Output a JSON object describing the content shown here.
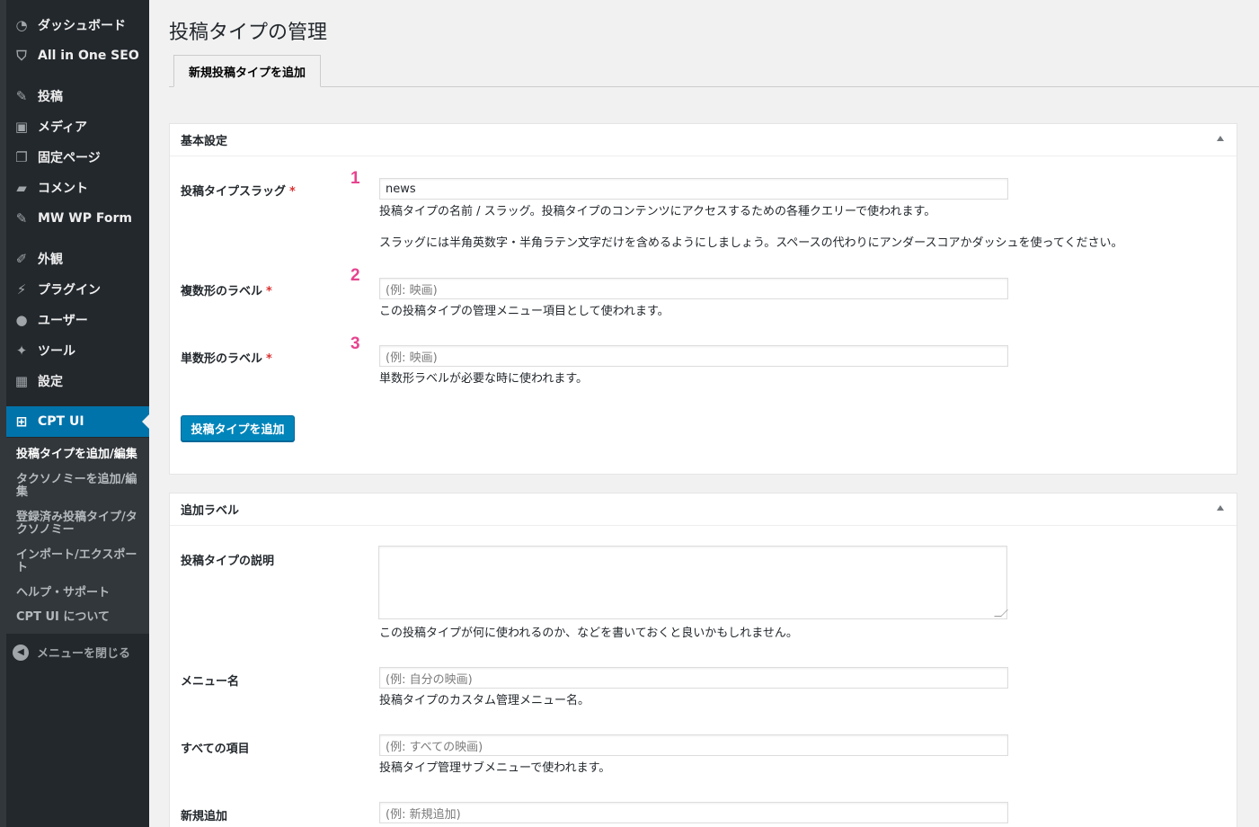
{
  "sidebar": {
    "items": [
      {
        "label": "ダッシュボード",
        "icon": "dashboard-icon"
      },
      {
        "label": "All in One SEO",
        "icon": "shield-icon"
      },
      {
        "label": "投稿",
        "icon": "pin-icon"
      },
      {
        "label": "メディア",
        "icon": "media-icon"
      },
      {
        "label": "固定ページ",
        "icon": "pages-icon"
      },
      {
        "label": "コメント",
        "icon": "comment-icon"
      },
      {
        "label": "MW WP Form",
        "icon": "pin-icon"
      },
      {
        "label": "外観",
        "icon": "brush-icon"
      },
      {
        "label": "プラグイン",
        "icon": "plugin-icon"
      },
      {
        "label": "ユーザー",
        "icon": "user-icon"
      },
      {
        "label": "ツール",
        "icon": "wrench-icon"
      },
      {
        "label": "設定",
        "icon": "settings-icon"
      },
      {
        "label": "CPT UI",
        "icon": "grid-icon"
      }
    ],
    "submenu": [
      "投稿タイプを追加/編集",
      "タクソノミーを追加/編集",
      "登録済み投稿タイプ/タクソノミー",
      "インポート/エクスポート",
      "ヘルプ・サポート",
      "CPT UI について"
    ],
    "collapse_label": "メニューを閉じる"
  },
  "main": {
    "title": "投稿タイプの管理",
    "tab": "新規投稿タイプを追加",
    "basic": {
      "heading": "基本設定",
      "slug": {
        "label": "投稿タイプスラッグ",
        "required": "*",
        "number": "1",
        "value": "news",
        "help1": "投稿タイプの名前 / スラッグ。投稿タイプのコンテンツにアクセスするための各種クエリーで使われます。",
        "help2": "スラッグには半角英数字・半角ラテン文字だけを含めるようにしましょう。スペースの代わりにアンダースコアかダッシュを使ってください。"
      },
      "plural": {
        "label": "複数形のラベル",
        "required": "*",
        "number": "2",
        "placeholder": "(例: 映画)",
        "help": "この投稿タイプの管理メニュー項目として使われます。"
      },
      "singular": {
        "label": "単数形のラベル",
        "required": "*",
        "number": "3",
        "placeholder": "(例: 映画)",
        "help": "単数形ラベルが必要な時に使われます。"
      },
      "submit": "投稿タイプを追加"
    },
    "extra": {
      "heading": "追加ラベル",
      "description": {
        "label": "投稿タイプの説明",
        "help": "この投稿タイプが何に使われるのか、などを書いておくと良いかもしれません。"
      },
      "menu_name": {
        "label": "メニュー名",
        "placeholder": "(例: 自分の映画)",
        "help": "投稿タイプのカスタム管理メニュー名。"
      },
      "all_items": {
        "label": "すべての項目",
        "placeholder": "(例: すべての映画)",
        "help": "投稿タイプ管理サブメニューで使われます。"
      },
      "add_new": {
        "label": "新規追加",
        "placeholder": "(例: 新規追加)"
      }
    }
  },
  "colors": {
    "sidebar": "#23282d",
    "accent": "#0073aa",
    "button": "#0085ba",
    "annotation": "#e6448f",
    "required": "#dc3232"
  }
}
